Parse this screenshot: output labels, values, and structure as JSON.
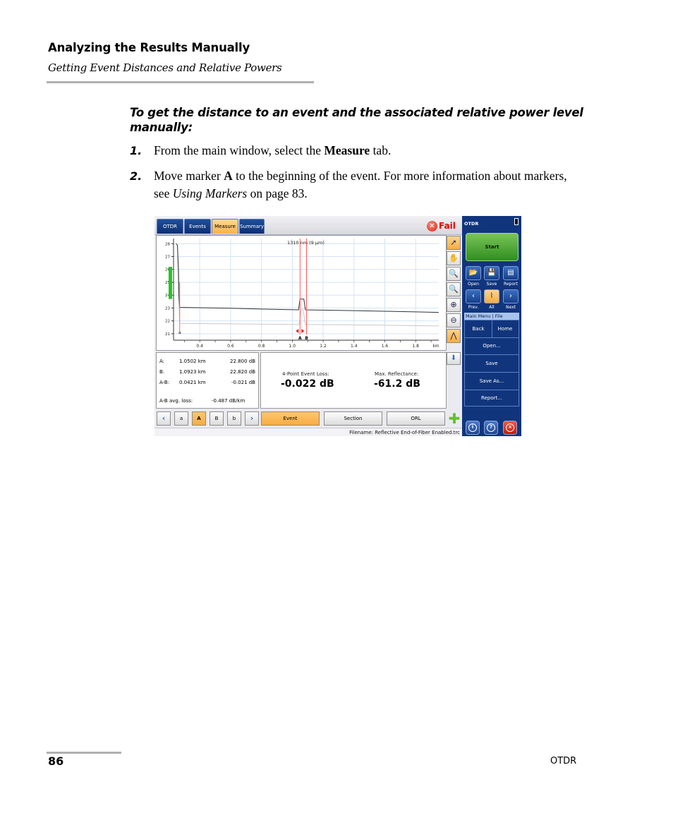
{
  "header": {
    "title": "Analyzing the Results Manually",
    "subtitle": "Getting Event Distances and Relative Powers"
  },
  "procedure": {
    "title": "To get the distance to an event and the associated relative power level manually:",
    "steps": [
      {
        "num": "1.",
        "pre": "From the main window, select the ",
        "bold": "Measure",
        "post": " tab."
      },
      {
        "num": "2.",
        "pre": "Move marker ",
        "bold": "A",
        "post": " to the beginning of the event. For more information about markers, see ",
        "italic": "Using Markers",
        "post2": " on page 83."
      }
    ]
  },
  "screenshot": {
    "tabs": [
      {
        "label": "OTDR",
        "active": false
      },
      {
        "label": "Events",
        "active": false
      },
      {
        "label": "Measure",
        "active": true
      },
      {
        "label": "Summary",
        "active": false
      }
    ],
    "status": {
      "icon": "fail-icon",
      "label": "Fail",
      "color": "#e60000"
    },
    "graph": {
      "wavelength_label": "1310 nm (9 µm)",
      "y_ticks": [
        "28",
        "27",
        "26",
        "25",
        "24",
        "23",
        "22",
        "21"
      ],
      "x_ticks": [
        "0.4",
        "0.6",
        "0.8",
        "1.0",
        "1.2",
        "1.4",
        "1.6",
        "1.8"
      ],
      "x_unit": "km",
      "marker_labels": {
        "a": "a",
        "A": "A",
        "B": "B"
      },
      "x_range_km": [
        0.23,
        1.95
      ],
      "y_range_db": [
        20.5,
        28.4
      ],
      "markers_km": {
        "a": 0.27,
        "A": 1.0502,
        "B": 1.0923
      },
      "trace_main": [
        [
          0.245,
          28.0
        ],
        [
          0.255,
          27.9
        ],
        [
          0.262,
          26.0
        ],
        [
          0.265,
          23.9
        ],
        [
          0.27,
          23.05
        ],
        [
          0.6,
          22.98
        ],
        [
          0.8,
          22.92
        ],
        [
          1.04,
          22.86
        ],
        [
          1.05,
          23.7
        ],
        [
          1.075,
          23.7
        ],
        [
          1.085,
          22.86
        ],
        [
          1.4,
          22.8
        ],
        [
          1.8,
          22.7
        ],
        [
          1.95,
          22.66
        ]
      ],
      "trace_ref": [
        [
          0.255,
          27.9
        ],
        [
          0.262,
          24.0
        ],
        [
          0.27,
          21.8
        ],
        [
          0.8,
          21.75
        ],
        [
          1.045,
          21.72
        ],
        [
          1.058,
          22.9
        ],
        [
          1.07,
          22.9
        ],
        [
          1.085,
          21.72
        ],
        [
          1.5,
          21.68
        ],
        [
          1.95,
          21.6
        ]
      ],
      "tools": [
        "cursor-icon",
        "hand-pan-icon",
        "zoom-marker-icon",
        "zoom-fit-icon",
        "zoom-in-icon",
        "zoom-out-icon",
        "full-trace-icon"
      ],
      "active_tools": [
        0,
        6
      ]
    },
    "markers_panel": {
      "rows": [
        {
          "label": "A:",
          "dist": "1.0502 km",
          "power": "22.800 dB"
        },
        {
          "label": "B:",
          "dist": "1.0923 km",
          "power": "22.820 dB"
        },
        {
          "label": "A-B:",
          "dist": "0.0421 km",
          "power": "-0.021 dB"
        }
      ],
      "avg_loss_label": "A-B avg. loss:",
      "avg_loss_value": "-0.487 dB/km"
    },
    "results_panel": {
      "event_loss_label": "4-Point Event Loss:",
      "event_loss_value": "-0.022 dB",
      "reflectance_label": "Max. Reflectance:",
      "reflectance_value": "-61.2 dB"
    },
    "marker_buttons": [
      {
        "label": "‹",
        "name": "prev-marker-button",
        "active": false
      },
      {
        "label": "a",
        "name": "marker-a-small-button",
        "active": false
      },
      {
        "label": "A",
        "name": "marker-A-button",
        "active": true
      },
      {
        "label": "B",
        "name": "marker-B-button",
        "active": false
      },
      {
        "label": "b",
        "name": "marker-b-small-button",
        "active": false
      },
      {
        "label": "›",
        "name": "next-marker-button",
        "active": false
      }
    ],
    "mode_buttons": [
      {
        "label": "Event",
        "active": true
      },
      {
        "label": "Section",
        "active": false
      },
      {
        "label": "ORL",
        "active": false
      }
    ],
    "filename": "Filename: Reflective End-of-Fiber Enabled.trc",
    "side": {
      "title": "OTDR",
      "start": "Start",
      "icons": [
        {
          "label": "Open",
          "icon": "folder-icon"
        },
        {
          "label": "Save",
          "icon": "floppy-icon"
        },
        {
          "label": "Report",
          "icon": "report-icon"
        },
        {
          "label": "Prev.",
          "icon": "prev-trace-icon"
        },
        {
          "label": "All",
          "icon": "all-traces-icon"
        },
        {
          "label": "Next",
          "icon": "next-trace-icon"
        }
      ],
      "menu_header": "Main Menu | File",
      "back": "Back",
      "home": "Home",
      "menu_items": [
        "Open...",
        "Save",
        "Save As...",
        "Report..."
      ]
    }
  },
  "footer": {
    "page_number": "86",
    "doc_name": "OTDR"
  }
}
